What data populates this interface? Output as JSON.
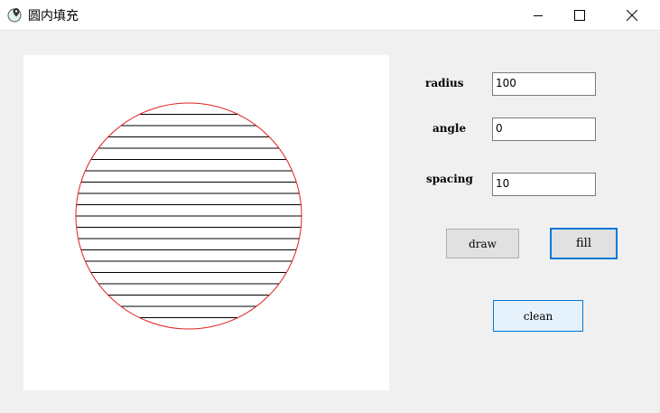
{
  "window": {
    "title": "圆内填充",
    "minimize": "minimize",
    "maximize": "maximize",
    "close": "close"
  },
  "form": {
    "radius_label": "radius",
    "radius_value": "100",
    "angle_label": "angle",
    "angle_value": "0",
    "spacing_label": "spacing",
    "spacing_value": "10",
    "draw_label": "draw",
    "fill_label": "fill",
    "clean_label": "clean"
  },
  "drawing": {
    "circle_color": "#e02020",
    "line_color": "#000000",
    "radius": 100,
    "angle": 0,
    "spacing": 10
  }
}
